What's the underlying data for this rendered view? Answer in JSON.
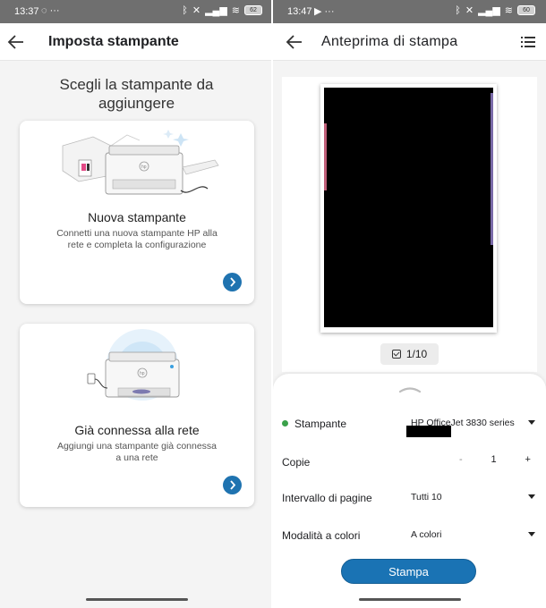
{
  "left_screen": {
    "status": {
      "time": "13:37",
      "icons": "◌ ···",
      "battery": "62"
    },
    "appbar": {
      "title": "Imposta stampante"
    },
    "heading": "Scegli la stampante da aggiungere",
    "cards": [
      {
        "title": "Nuova stampante",
        "description": "Connetti una nuova stampante HP alla rete e completa la configurazione"
      },
      {
        "title": "Già connessa alla rete",
        "description": "Aggiungi una stampante già connessa a una rete"
      }
    ]
  },
  "right_screen": {
    "status": {
      "time": "13:47",
      "icons": "▶ ···",
      "battery": "60"
    },
    "appbar": {
      "title": "Anteprima di stampa"
    },
    "pager": "1/10",
    "settings": {
      "printer": {
        "label": "Stampante",
        "value": "HP OfficeJet 3830 series"
      },
      "copies": {
        "label": "Copie",
        "minus": "-",
        "value": "1",
        "plus": "+"
      },
      "range": {
        "label": "Intervallo di pagine",
        "value": "Tutti 10"
      },
      "color": {
        "label": "Modalità a colori",
        "value": "A colori"
      }
    },
    "print_button": "Stampa"
  },
  "colors": {
    "accent": "#1a73b4",
    "status_bar": "#6f6f6f",
    "printer_online": "#3aa14a"
  }
}
